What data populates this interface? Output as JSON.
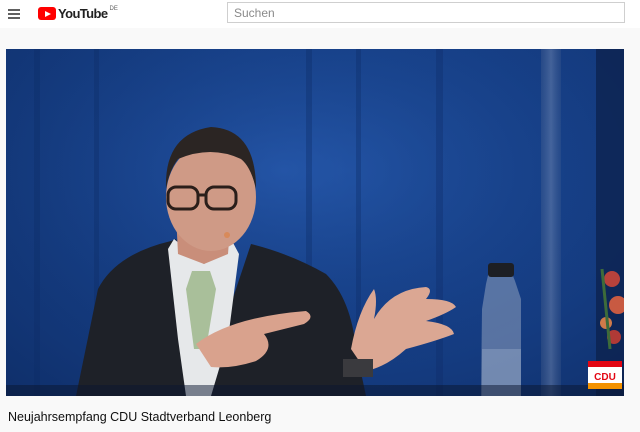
{
  "masthead": {
    "logo_text": "YouTube",
    "logo_region": "DE",
    "search_placeholder": "Suchen"
  },
  "player": {
    "overlay_logo_text": "CDU"
  },
  "video": {
    "title": "Neujahrsempfang CDU Stadtverband Leonberg"
  },
  "colors": {
    "brand_red": "#ff0000",
    "backdrop_blue": "#17418a",
    "cdu_red": "#e30613",
    "cdu_orange": "#f39200"
  }
}
